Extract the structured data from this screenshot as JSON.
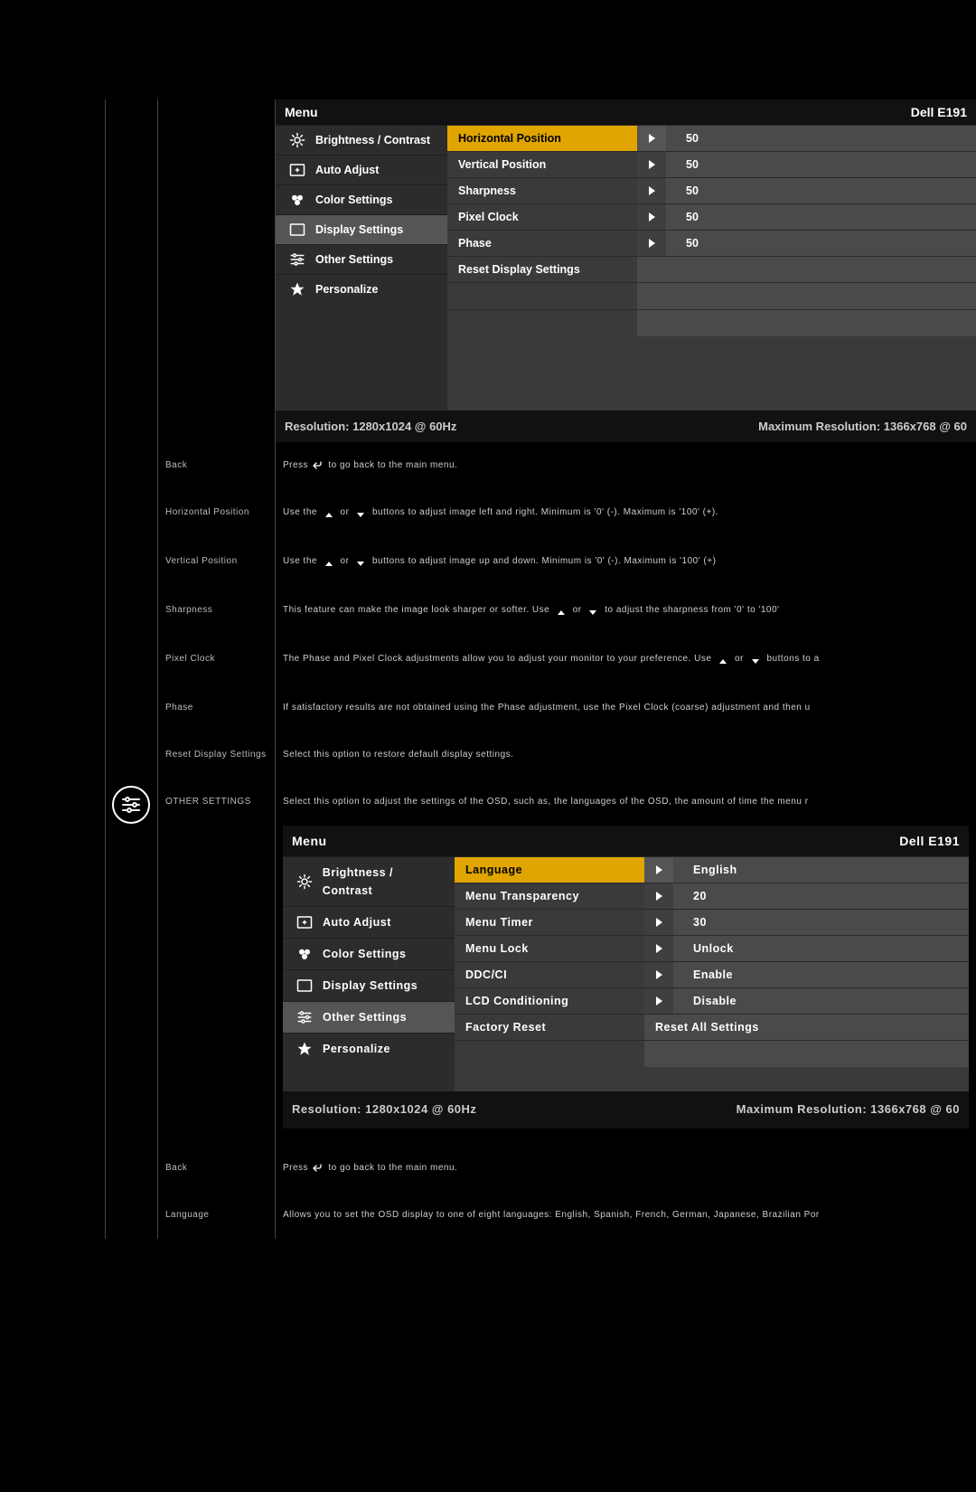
{
  "osd_header": {
    "menu": "Menu",
    "model": "Dell E191"
  },
  "osd_footer": {
    "res": "Resolution: 1280x1024 @ 60Hz",
    "max": "Maximum Resolution: 1366x768 @ 60"
  },
  "nav": {
    "brightness": "Brightness / Contrast",
    "auto": "Auto Adjust",
    "color": "Color Settings",
    "display": "Display Settings",
    "other": "Other Settings",
    "personalize": "Personalize"
  },
  "osd1_sub": [
    {
      "label": "Horizontal Position",
      "value": "50",
      "highlight": true,
      "arrow": true
    },
    {
      "label": "Vertical Position",
      "value": "50",
      "arrow": true
    },
    {
      "label": "Sharpness",
      "value": "50",
      "arrow": true
    },
    {
      "label": "Pixel Clock",
      "value": "50",
      "arrow": true
    },
    {
      "label": "Phase",
      "value": "50",
      "arrow": true
    },
    {
      "label": "Reset Display Settings",
      "value": "",
      "arrow": false
    }
  ],
  "osd2_sub": [
    {
      "label": "Language",
      "value": "English",
      "highlight": true,
      "arrow": true
    },
    {
      "label": "Menu Transparency",
      "value": "20",
      "arrow": true
    },
    {
      "label": "Menu Timer",
      "value": "30",
      "arrow": true
    },
    {
      "label": "Menu Lock",
      "value": "Unlock",
      "arrow": true
    },
    {
      "label": "DDC/CI",
      "value": "Enable",
      "arrow": true
    },
    {
      "label": "LCD Conditioning",
      "value": "Disable",
      "arrow": true
    },
    {
      "label": "Factory Reset",
      "value": "Reset All Settings",
      "arrow": false
    }
  ],
  "rows": {
    "back": {
      "label": "Back",
      "pre": "Press",
      "post": " to go back to the main menu."
    },
    "hpos": {
      "label": "Horizontal Position",
      "pre": "Use the ",
      "mid": " or ",
      "post": " buttons to adjust image left and right. Minimum is '0' (-). Maximum is '100' (+)."
    },
    "vpos": {
      "label": "Vertical Position",
      "pre": "Use the ",
      "mid": " or ",
      "post": " buttons to adjust image up and down. Minimum is '0' (-). Maximum is '100' (+)"
    },
    "sharp": {
      "label": "Sharpness",
      "pre": "This feature can make the image look sharper or softer. Use ",
      "mid": " or ",
      "post": " to adjust the sharpness from '0' to '100'"
    },
    "pclk": {
      "label": "Pixel Clock",
      "pre": "The Phase and Pixel Clock adjustments allow you to adjust your monitor to your preference. Use ",
      "mid": " or ",
      "post": " buttons to a"
    },
    "phase": {
      "label": "Phase",
      "text": "If satisfactory results are not obtained using the Phase adjustment, use the Pixel Clock (coarse) adjustment and then u"
    },
    "reset": {
      "label": "Reset Display Settings",
      "text": "Select this option to restore default display settings."
    },
    "other": {
      "label": "OTHER SETTINGS",
      "text": "Select this option to adjust the settings of the OSD, such as, the languages of the OSD, the amount of time the menu r"
    },
    "back2": {
      "label": "Back",
      "pre": "Press",
      "post": " to go back to the main menu."
    },
    "lang": {
      "label": "Language",
      "text": "Allows you to set the OSD display to one of eight languages: English, Spanish, French, German, Japanese, Brazilian Por"
    }
  }
}
